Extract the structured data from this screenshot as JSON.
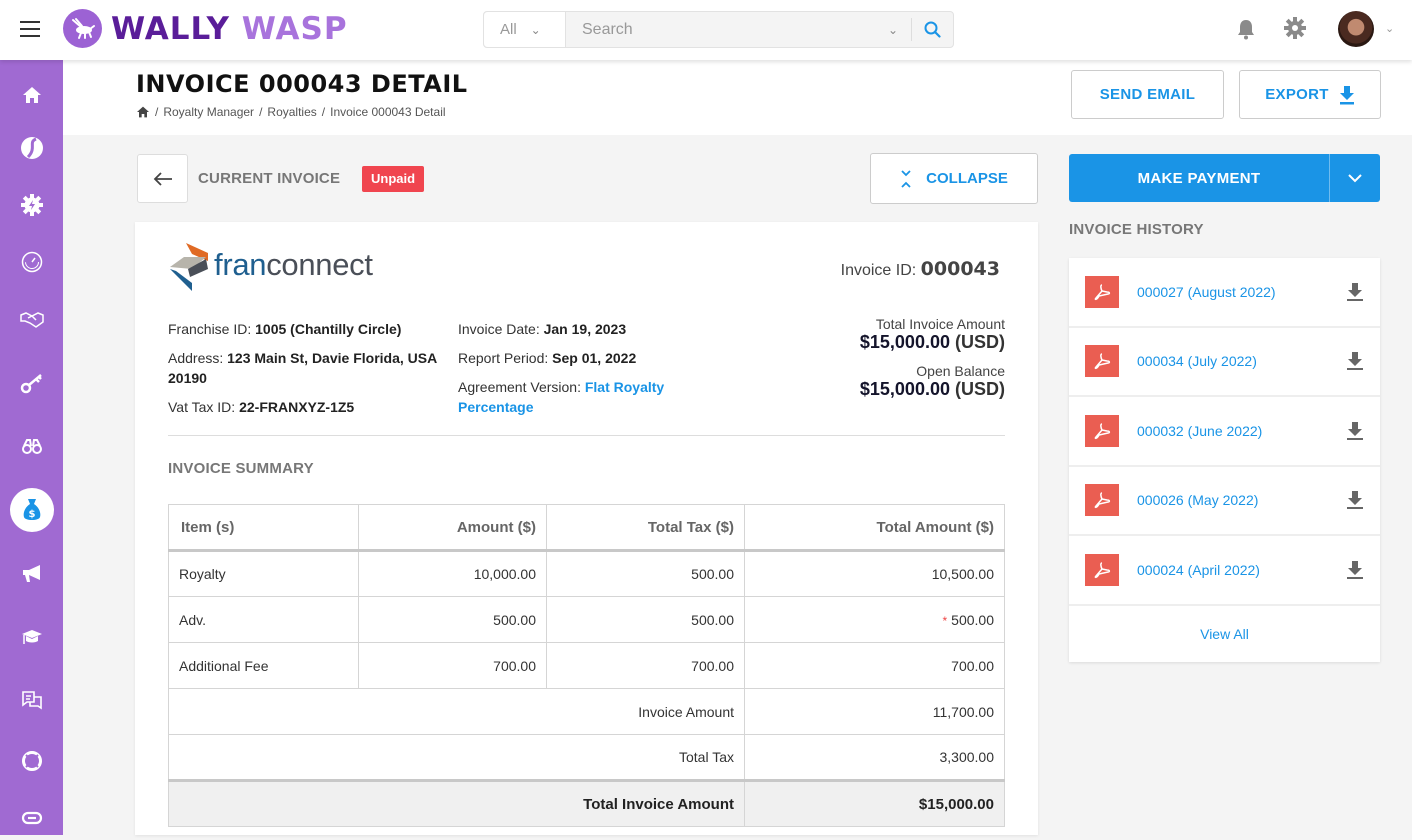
{
  "app": {
    "brand_part1": "WALLY",
    "brand_part2": "WASP"
  },
  "search": {
    "category": "All",
    "placeholder": "Search"
  },
  "colors": {
    "accent": "#1a94e6",
    "sidebar": "#a06ad2",
    "unpaid": "#f0454f",
    "pdf": "#ea5e52"
  },
  "sidebar": {
    "items": [
      {
        "icon": "home-icon"
      },
      {
        "icon": "brand-s-icon"
      },
      {
        "icon": "gear-bolt-icon"
      },
      {
        "icon": "speedometer-icon"
      },
      {
        "icon": "handshake-icon"
      },
      {
        "icon": "key-icon"
      },
      {
        "icon": "binoculars-icon"
      },
      {
        "icon": "money-bag-icon",
        "active": true
      },
      {
        "icon": "megaphone-icon"
      },
      {
        "icon": "graduation-cap-icon"
      },
      {
        "icon": "chat-icon"
      },
      {
        "icon": "lifebuoy-icon"
      },
      {
        "icon": "link-icon"
      }
    ]
  },
  "header": {
    "title": "INVOICE 000043 DETAIL",
    "breadcrumb": [
      "Royalty Manager",
      "Royalties",
      "Invoice 000043 Detail"
    ],
    "send_email": "SEND EMAIL",
    "export": "EXPORT"
  },
  "invoice": {
    "current_label": "CURRENT INVOICE",
    "status": "Unpaid",
    "collapse": "COLLAPSE",
    "company_logo": {
      "part1": "fran",
      "part2": "connect"
    },
    "id_label": "Invoice ID:",
    "id": "000043",
    "franchise_id_label": "Franchise ID:",
    "franchise_id": "1005 (Chantilly Circle)",
    "address_label": "Address:",
    "address": "123 Main St, Davie Florida, USA 20190",
    "vat_label": "Vat Tax ID:",
    "vat": "22-FRANXYZ-1Z5",
    "invoice_date_label": "Invoice Date:",
    "invoice_date": "Jan 19, 2023",
    "report_period_label": "Report Period:",
    "report_period": "Sep 01, 2022",
    "agreement_label": "Agreement Version:",
    "agreement": "Flat Royalty Percentage",
    "total_label": "Total Invoice Amount",
    "total_amount": "$15,000.00",
    "total_currency": "(USD)",
    "open_label": "Open Balance",
    "open_amount": "$15,000.00",
    "open_currency": "(USD)"
  },
  "summary": {
    "title": "INVOICE SUMMARY",
    "columns": [
      "Item (s)",
      "Amount ($)",
      "Total Tax ($)",
      "Total Amount ($)"
    ],
    "rows": [
      {
        "item": "Royalty",
        "amount": "10,000.00",
        "tax": "500.00",
        "total": "10,500.00"
      },
      {
        "item": "Adv.",
        "amount": "500.00",
        "tax": "500.00",
        "total": "500.00",
        "flag": "*"
      },
      {
        "item": "Additional Fee",
        "amount": "700.00",
        "tax": "700.00",
        "total": "700.00"
      }
    ],
    "invoice_amount_label": "Invoice Amount",
    "invoice_amount": "11,700.00",
    "total_tax_label": "Total Tax",
    "total_tax": "3,300.00",
    "grand_total_label": "Total Invoice Amount",
    "grand_total": "$15,000.00"
  },
  "side": {
    "make_payment": "MAKE PAYMENT",
    "history_title": "INVOICE HISTORY",
    "history": [
      {
        "label": "000027 (August 2022)"
      },
      {
        "label": "000034 (July 2022)"
      },
      {
        "label": "000032 (June 2022)"
      },
      {
        "label": "000026 (May 2022)"
      },
      {
        "label": "000024 (April 2022)"
      }
    ],
    "view_all": "View All"
  }
}
